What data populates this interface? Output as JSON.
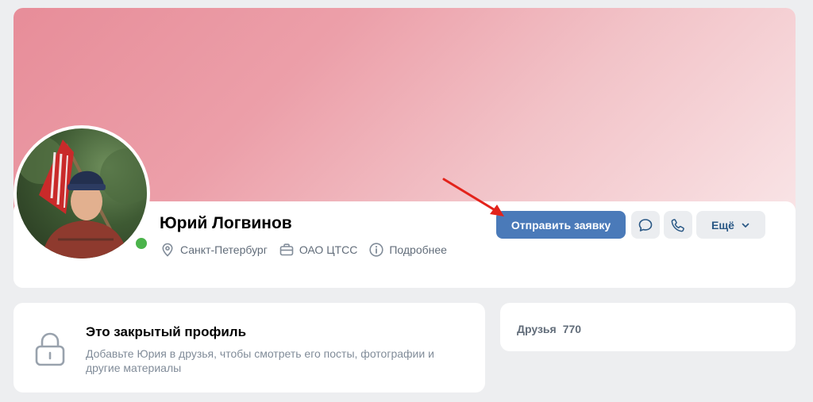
{
  "profile": {
    "name": "Юрий Логвинов",
    "online": true,
    "location": "Санкт-Петербург",
    "workplace": "ОАО ЦТСС",
    "details_label": "Подробнее"
  },
  "actions": {
    "send_request_label": "Отправить заявку",
    "message_icon": "message-icon",
    "call_icon": "phone-icon",
    "more_label": "Ещё"
  },
  "closed_profile": {
    "title": "Это закрытый профиль",
    "description": "Добавьте Юрия в друзья, чтобы смотреть его посты, фотографии и другие материалы"
  },
  "friends": {
    "label": "Друзья",
    "count": "770"
  },
  "colors": {
    "primary_button": "#4a7ab9",
    "online": "#4bb34b",
    "annotation_arrow": "#e3231b",
    "background": "#edeef0"
  }
}
